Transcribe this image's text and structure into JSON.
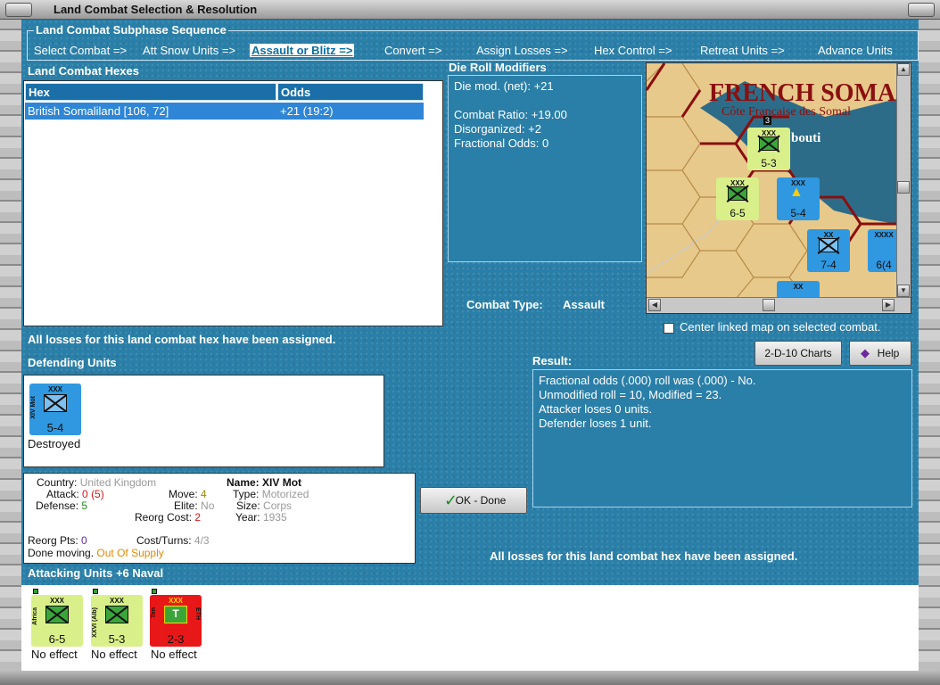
{
  "window": {
    "title": "Land Combat Selection & Resolution"
  },
  "sequence": {
    "heading": "Land Combat Subphase Sequence",
    "steps": [
      "Select Combat =>",
      "Att Snow Units =>",
      "Assault or Blitz =>",
      "Convert =>",
      "Assign Losses =>",
      "Hex Control =>",
      "Retreat Units =>",
      "Advance Units"
    ],
    "active_index": 2
  },
  "combat_hexes": {
    "heading": "Land Combat Hexes",
    "columns": [
      "Hex",
      "Odds"
    ],
    "rows": [
      {
        "hex": "British Somaliland [106, 72]",
        "odds": "+21 (19:2)"
      }
    ]
  },
  "die_roll": {
    "heading": "Die Roll Modifiers",
    "lines": [
      "Die mod. (net): +21",
      "",
      "Combat Ratio: +19.00",
      "Disorganized: +2",
      "Fractional Odds: 0"
    ]
  },
  "combat_type": {
    "label": "Combat Type:",
    "value": "Assault"
  },
  "map": {
    "title": "FRENCH SOMA",
    "subtitle": "Côte Française des Somal",
    "place": "bouti",
    "counters": [
      {
        "side": "XXVI (Alb)",
        "vals": "5-3",
        "color": "green",
        "badge": "3"
      },
      {
        "side": "Africa",
        "vals": "6-5",
        "color": "green"
      },
      {
        "side": "XIV Mot",
        "vals": "5-4",
        "color": "blue"
      },
      {
        "side": "",
        "vals": "7-4",
        "color": "blue"
      },
      {
        "side": "",
        "vals": "6(4",
        "color": "blue"
      },
      {
        "side": "",
        "vals": "",
        "color": "blue"
      }
    ]
  },
  "center_linked": {
    "label": "Center linked map on selected combat.",
    "checked": false
  },
  "status_msg": "All losses for this land combat hex have been assigned.",
  "buttons": {
    "charts": "2-D-10 Charts",
    "help": "Help",
    "ok": "OK - Done"
  },
  "defending": {
    "heading": "Defending Units",
    "units": [
      {
        "side": "XIV Mot",
        "vals": "5-4",
        "size": "XXX",
        "color": "blue",
        "result": "Destroyed"
      }
    ]
  },
  "unit_info": {
    "country_label": "Country:",
    "country": "United Kingdom",
    "name_label": "Name:",
    "name": "XIV Mot",
    "attack_label": "Attack:",
    "attack": "0",
    "attack_paren": "(5)",
    "move_label": "Move:",
    "move": "4",
    "type_label": "Type:",
    "type": "Motorized",
    "defense_label": "Defense:",
    "defense": "5",
    "elite_label": "Elite:",
    "elite": "No",
    "size_label": "Size:",
    "size": "Corps",
    "reorg_cost_label": "Reorg Cost:",
    "reorg_cost": "2",
    "year_label": "Year:",
    "year": "1935",
    "reorg_pts_label": "Reorg Pts:",
    "reorg_pts": "0",
    "cost_turns_label": "Cost/Turns:",
    "cost_turns": "4/3",
    "done_moving": "Done moving.",
    "supply": "Out Of Supply"
  },
  "result": {
    "heading": "Result:",
    "lines": [
      "Fractional odds (.000) roll was (.000)  - No.",
      "Unmodified roll = 10, Modified = 23.",
      "Attacker loses 0 units.",
      "Defender loses 1 unit."
    ]
  },
  "attacking": {
    "heading": "Attacking Units +6 Naval",
    "units": [
      {
        "side": "Africa",
        "vals": "6-5",
        "size": "XXX",
        "color": "green",
        "result": "No effect"
      },
      {
        "side": "XXVI (Alb)",
        "vals": "5-3",
        "size": "XXX",
        "color": "green",
        "result": "No effect"
      },
      {
        "side": "Ten",
        "side2": "ETH",
        "vals": "2-3",
        "size": "XXX",
        "color": "red",
        "result": "No effect"
      }
    ]
  },
  "colors": {
    "panel": "#2a7fa8",
    "selected_row": "#2f86d6",
    "map_land": "#e8c98a"
  }
}
